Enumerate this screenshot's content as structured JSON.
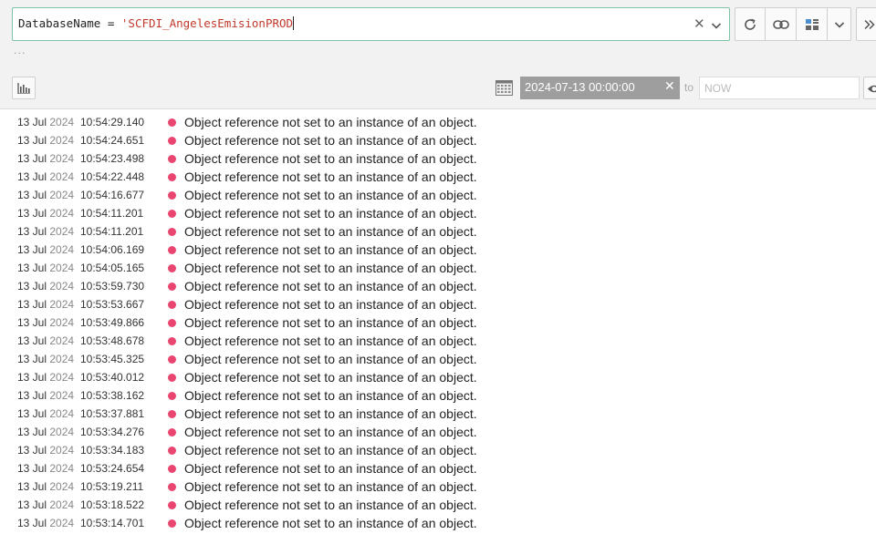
{
  "query": {
    "field": "DatabaseName",
    "operator": "=",
    "value": "'SCFDI_AngelesEmisionPROD"
  },
  "ellipsis": "...",
  "time_range": {
    "from": "2024-07-13 00:00:00",
    "to_label": "to",
    "to_placeholder": "NOW"
  },
  "colors": {
    "accent": "#7fc3a6",
    "error_level": "#e8466e",
    "string_literal": "#c0392b"
  },
  "logs": [
    {
      "date": "13 Jul",
      "year": "2024",
      "time": "10:54:29.140",
      "message": "Object reference not set to an instance of an object."
    },
    {
      "date": "13 Jul",
      "year": "2024",
      "time": "10:54:24.651",
      "message": "Object reference not set to an instance of an object."
    },
    {
      "date": "13 Jul",
      "year": "2024",
      "time": "10:54:23.498",
      "message": "Object reference not set to an instance of an object."
    },
    {
      "date": "13 Jul",
      "year": "2024",
      "time": "10:54:22.448",
      "message": "Object reference not set to an instance of an object."
    },
    {
      "date": "13 Jul",
      "year": "2024",
      "time": "10:54:16.677",
      "message": "Object reference not set to an instance of an object."
    },
    {
      "date": "13 Jul",
      "year": "2024",
      "time": "10:54:11.201",
      "message": "Object reference not set to an instance of an object."
    },
    {
      "date": "13 Jul",
      "year": "2024",
      "time": "10:54:11.201",
      "message": "Object reference not set to an instance of an object."
    },
    {
      "date": "13 Jul",
      "year": "2024",
      "time": "10:54:06.169",
      "message": "Object reference not set to an instance of an object."
    },
    {
      "date": "13 Jul",
      "year": "2024",
      "time": "10:54:05.165",
      "message": "Object reference not set to an instance of an object."
    },
    {
      "date": "13 Jul",
      "year": "2024",
      "time": "10:53:59.730",
      "message": "Object reference not set to an instance of an object."
    },
    {
      "date": "13 Jul",
      "year": "2024",
      "time": "10:53:53.667",
      "message": "Object reference not set to an instance of an object."
    },
    {
      "date": "13 Jul",
      "year": "2024",
      "time": "10:53:49.866",
      "message": "Object reference not set to an instance of an object."
    },
    {
      "date": "13 Jul",
      "year": "2024",
      "time": "10:53:48.678",
      "message": "Object reference not set to an instance of an object."
    },
    {
      "date": "13 Jul",
      "year": "2024",
      "time": "10:53:45.325",
      "message": "Object reference not set to an instance of an object."
    },
    {
      "date": "13 Jul",
      "year": "2024",
      "time": "10:53:40.012",
      "message": "Object reference not set to an instance of an object."
    },
    {
      "date": "13 Jul",
      "year": "2024",
      "time": "10:53:38.162",
      "message": "Object reference not set to an instance of an object."
    },
    {
      "date": "13 Jul",
      "year": "2024",
      "time": "10:53:37.881",
      "message": "Object reference not set to an instance of an object."
    },
    {
      "date": "13 Jul",
      "year": "2024",
      "time": "10:53:34.276",
      "message": "Object reference not set to an instance of an object."
    },
    {
      "date": "13 Jul",
      "year": "2024",
      "time": "10:53:34.183",
      "message": "Object reference not set to an instance of an object."
    },
    {
      "date": "13 Jul",
      "year": "2024",
      "time": "10:53:24.654",
      "message": "Object reference not set to an instance of an object."
    },
    {
      "date": "13 Jul",
      "year": "2024",
      "time": "10:53:19.211",
      "message": "Object reference not set to an instance of an object."
    },
    {
      "date": "13 Jul",
      "year": "2024",
      "time": "10:53:18.522",
      "message": "Object reference not set to an instance of an object."
    },
    {
      "date": "13 Jul",
      "year": "2024",
      "time": "10:53:14.701",
      "message": "Object reference not set to an instance of an object."
    }
  ]
}
